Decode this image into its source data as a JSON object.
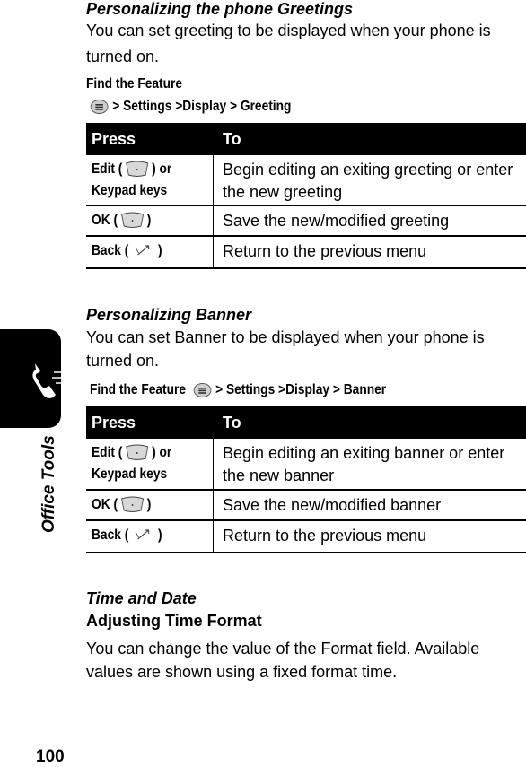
{
  "page": {
    "number": "100",
    "side_tab_label": "Office Tools",
    "side_tab_icon": "phone-handset-icon"
  },
  "greetings": {
    "heading": "Personalizing the phone Greetings",
    "intro": "You can set greeting to be displayed when your phone is turned on.",
    "find_feature_label": "Find the Feature",
    "menu_icon": "menu-key-icon",
    "path": "> Settings >Display > Greeting",
    "table": {
      "headers": [
        "Press",
        "To"
      ],
      "rows": [
        {
          "press_prefix": "Edit (",
          "press_icon": "soft-key-icon",
          "press_suffix": ") or",
          "press_line2": "Keypad keys",
          "to": "Begin editing an exiting greeting or enter the new greeting"
        },
        {
          "press_prefix": "OK (",
          "press_icon": "soft-key-icon",
          "press_suffix": ")",
          "press_line2": "",
          "to": "Save the new/modified greeting"
        },
        {
          "press_prefix": "Back (",
          "press_icon": "back-key-icon",
          "press_suffix": ")",
          "press_line2": "",
          "to": "Return to the previous menu"
        }
      ]
    }
  },
  "banner": {
    "heading": "Personalizing Banner",
    "intro": "You can set Banner to be displayed when your phone is turned on.",
    "find_feature_label": "Find the Feature",
    "menu_icon": "menu-key-icon",
    "path": "> Settings >Display > Banner",
    "table": {
      "headers": [
        "Press",
        "To"
      ],
      "rows": [
        {
          "press_prefix": "Edit (",
          "press_icon": "soft-key-icon",
          "press_suffix": ") or",
          "press_line2": "Keypad keys",
          "to": "Begin editing an exiting banner or enter the new banner"
        },
        {
          "press_prefix": "OK (",
          "press_icon": "soft-key-icon",
          "press_suffix": ")",
          "press_line2": "",
          "to": "Save the new/modified banner"
        },
        {
          "press_prefix": "Back (",
          "press_icon": "back-key-icon",
          "press_suffix": ")",
          "press_line2": "",
          "to": "Return to the previous menu"
        }
      ]
    }
  },
  "time_date": {
    "heading": "Time and Date",
    "subheading": "Adjusting Time Format",
    "body": "You can change the value of the Format field. Available values are shown using a fixed format time."
  }
}
